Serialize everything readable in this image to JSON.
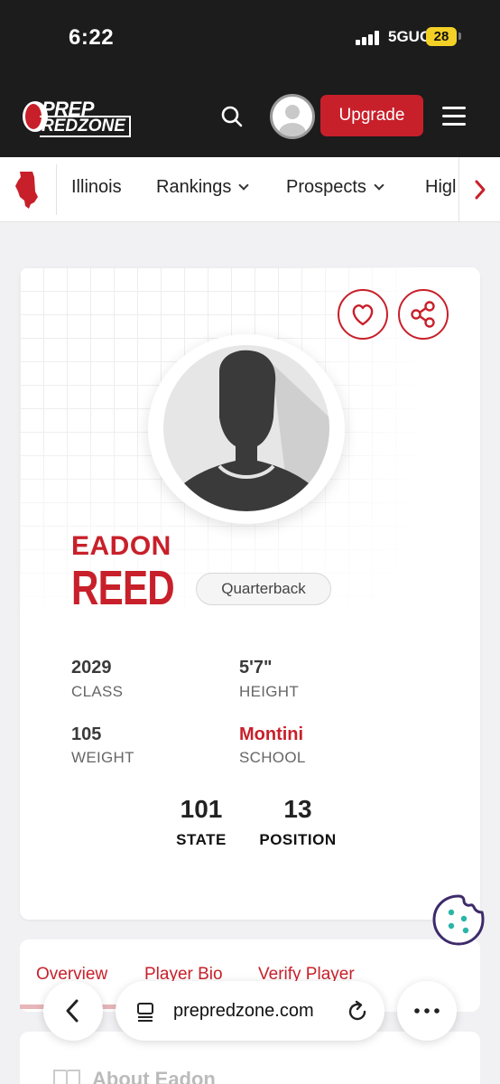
{
  "status_bar": {
    "time": "6:22",
    "network": "5GUC",
    "battery": "28"
  },
  "header": {
    "logo_top": "PREP",
    "logo_bottom": "REDZONE",
    "upgrade_label": "Upgrade"
  },
  "subnav": {
    "items": [
      {
        "label": "Illinois",
        "has_dropdown": false
      },
      {
        "label": "Rankings",
        "has_dropdown": true
      },
      {
        "label": "Prospects",
        "has_dropdown": true
      },
      {
        "label": "Higl",
        "has_dropdown": false
      }
    ]
  },
  "profile": {
    "first_name": "EADON",
    "last_name": "REED",
    "position": "Quarterback",
    "stats": [
      {
        "value": "2029",
        "label": "CLASS"
      },
      {
        "value": "5'7\"",
        "label": "HEIGHT"
      },
      {
        "value": "105",
        "label": "WEIGHT"
      },
      {
        "value": "Montini",
        "label": "SCHOOL"
      }
    ],
    "ranks": [
      {
        "value": "101",
        "label": "STATE"
      },
      {
        "value": "13",
        "label": "POSITION"
      }
    ]
  },
  "tabs": [
    "Overview",
    "Player Bio",
    "Verify Player"
  ],
  "about": {
    "title": "About Eadon"
  },
  "browser": {
    "url": "prepredzone.com"
  },
  "colors": {
    "accent": "#c8202a",
    "dark": "#1c1c1c"
  }
}
